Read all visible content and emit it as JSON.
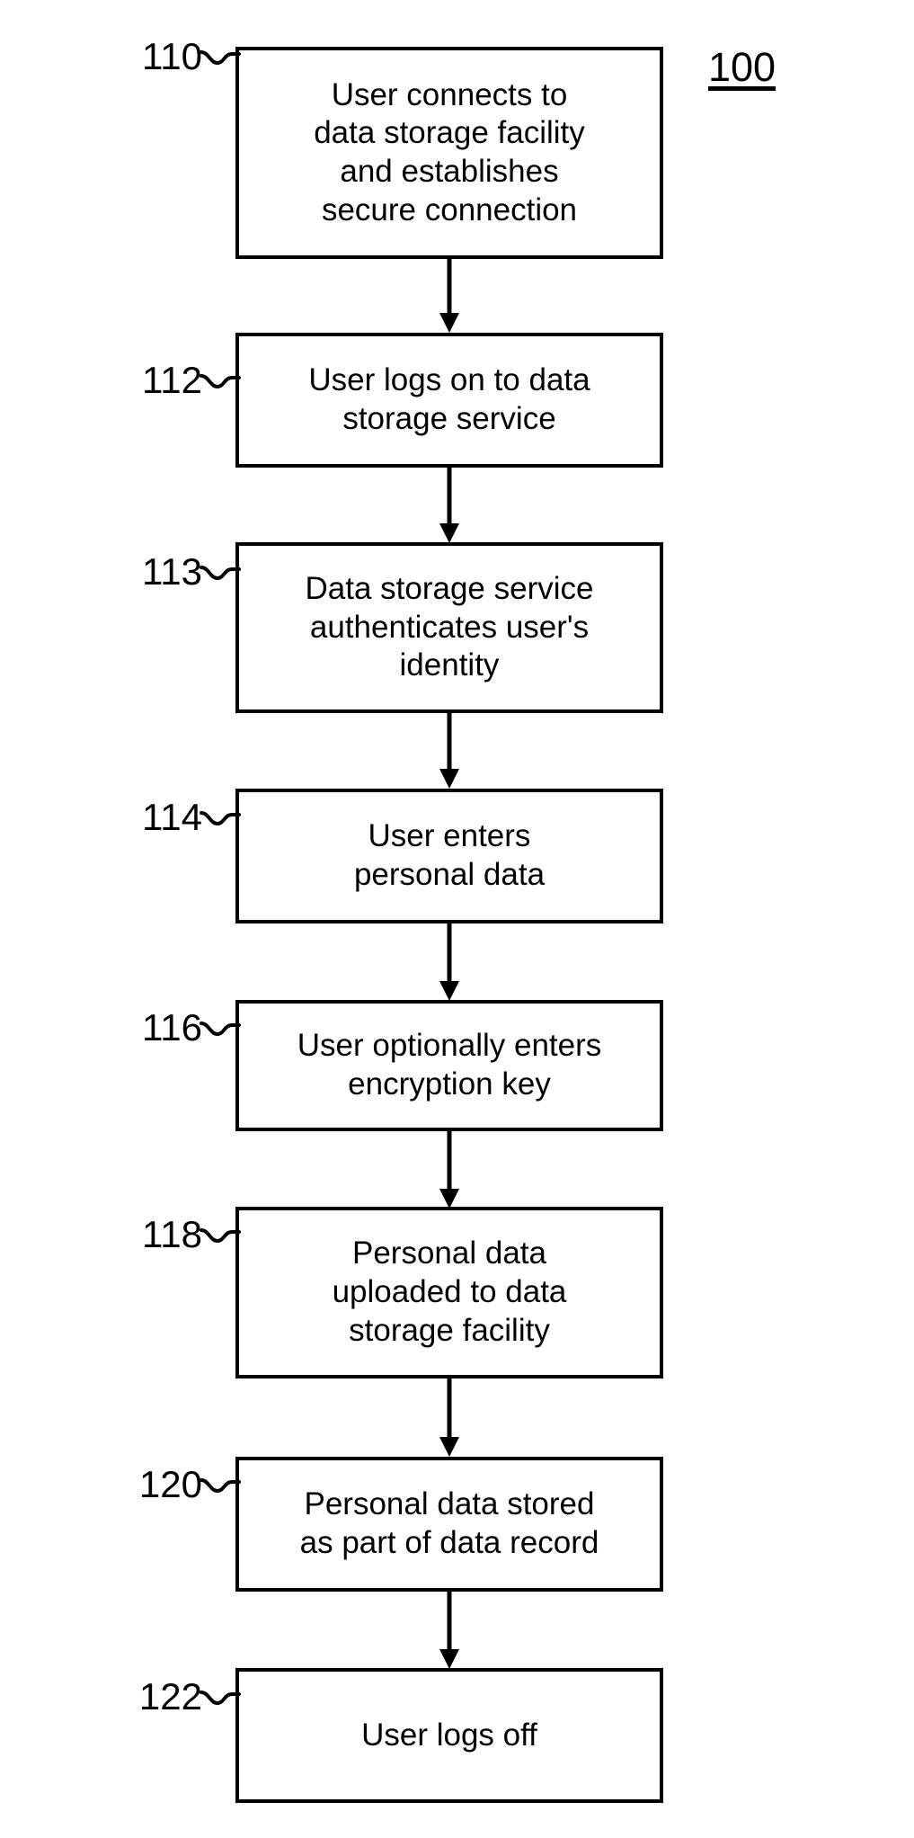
{
  "figure": {
    "number_label": "100"
  },
  "nodes": [
    {
      "ref": "110",
      "text": "User connects to\ndata storage facility\nand establishes\nsecure connection"
    },
    {
      "ref": "112",
      "text": "User logs on to data\nstorage service"
    },
    {
      "ref": "113",
      "text": "Data storage service\nauthenticates user's\nidentity"
    },
    {
      "ref": "114",
      "text": "User enters\npersonal data"
    },
    {
      "ref": "116",
      "text": "User optionally enters\nencryption key"
    },
    {
      "ref": "118",
      "text": "Personal data\nuploaded to data\nstorage facility"
    },
    {
      "ref": "120",
      "text": "Personal data stored\nas part of data record"
    },
    {
      "ref": "122",
      "text": "User logs off"
    }
  ],
  "chart_data": {
    "type": "diagram",
    "diagram_kind": "flowchart",
    "title": "100",
    "orientation": "vertical",
    "stroke_color": "#000000",
    "fill_color": "#ffffff",
    "steps": [
      {
        "id": "110",
        "label": "User connects to data storage facility and establishes secure connection"
      },
      {
        "id": "112",
        "label": "User logs on to data storage service"
      },
      {
        "id": "113",
        "label": "Data storage service authenticates user's identity"
      },
      {
        "id": "114",
        "label": "User enters personal data"
      },
      {
        "id": "116",
        "label": "User optionally enters encryption key"
      },
      {
        "id": "118",
        "label": "Personal data uploaded to data storage facility"
      },
      {
        "id": "120",
        "label": "Personal data stored as part of data record"
      },
      {
        "id": "122",
        "label": "User logs off"
      }
    ],
    "edges": [
      {
        "from": "110",
        "to": "112"
      },
      {
        "from": "112",
        "to": "113"
      },
      {
        "from": "113",
        "to": "114"
      },
      {
        "from": "114",
        "to": "116"
      },
      {
        "from": "116",
        "to": "118"
      },
      {
        "from": "118",
        "to": "120"
      },
      {
        "from": "120",
        "to": "122"
      }
    ]
  }
}
